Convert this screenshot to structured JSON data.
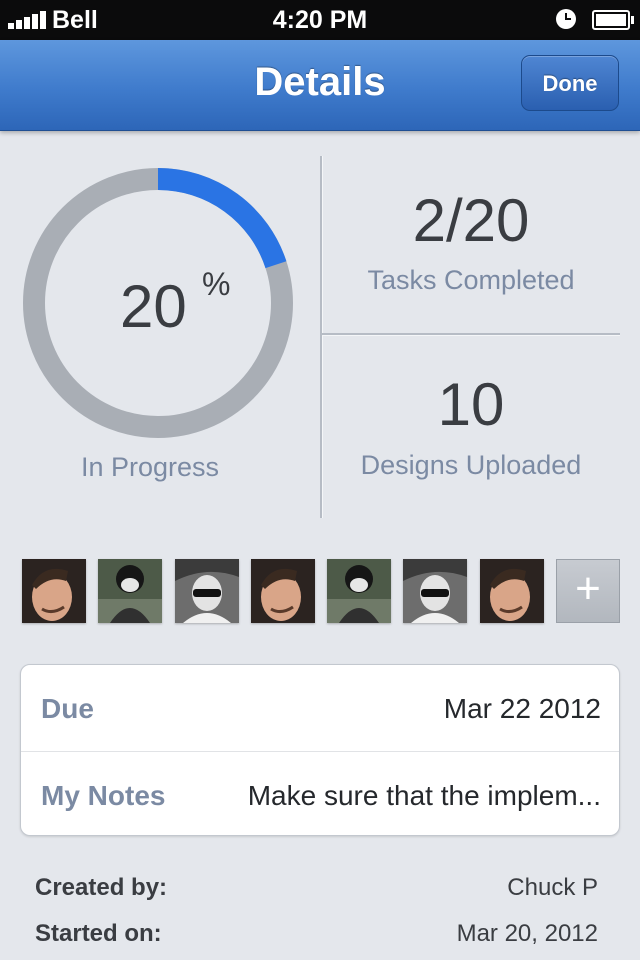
{
  "status_bar": {
    "carrier": "Bell",
    "time": "4:20 PM"
  },
  "nav": {
    "title": "Details",
    "done_label": "Done"
  },
  "progress": {
    "value": "20",
    "unit": "%",
    "label": "In Progress",
    "fraction": 0.2,
    "accent_color": "#2a74e4"
  },
  "stats": [
    {
      "value": "2/20",
      "label": "Tasks Completed"
    },
    {
      "value": "10",
      "label": "Designs Uploaded"
    }
  ],
  "avatars": [
    "person-smiling-portrait",
    "person-with-helmet-portrait",
    "person-with-sunglasses-portrait",
    "person-smiling-portrait",
    "person-with-helmet-portrait",
    "person-with-sunglasses-portrait",
    "person-smiling-portrait"
  ],
  "add_button": {
    "icon": "plus-icon",
    "label": "+"
  },
  "details": {
    "due_label": "Due",
    "due_value": "Mar 22 2012",
    "notes_label": "My Notes",
    "notes_value": "Make sure that the implem..."
  },
  "footer": {
    "created_label": "Created by:",
    "created_value": "Chuck P",
    "started_label": "Started on:",
    "started_value": "Mar 20, 2012"
  }
}
